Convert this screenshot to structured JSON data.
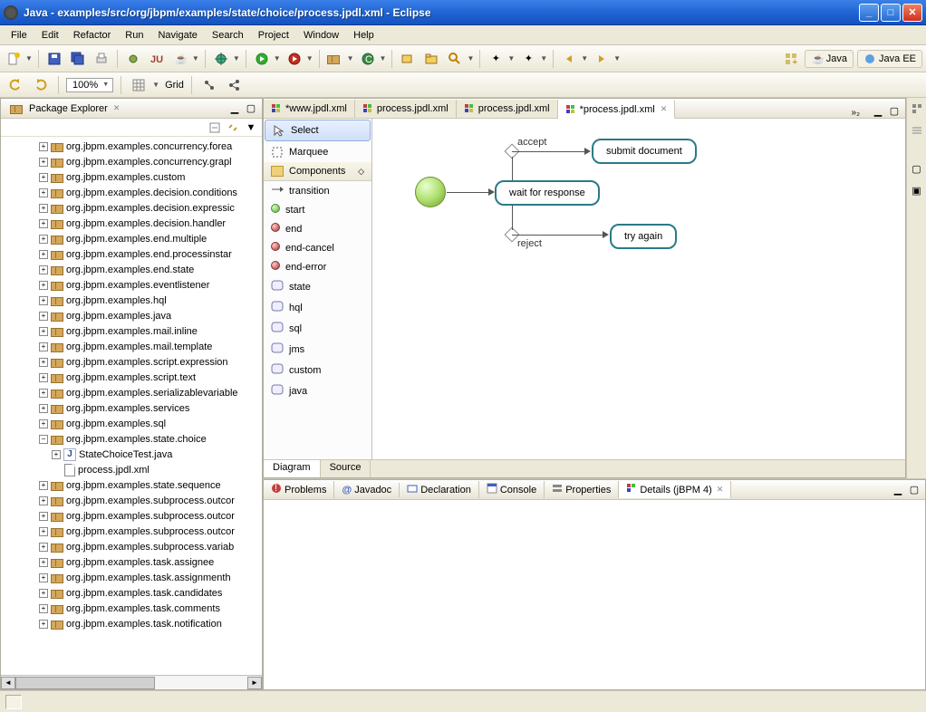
{
  "window": {
    "title": "Java - examples/src/org/jbpm/examples/state/choice/process.jpdl.xml - Eclipse"
  },
  "menu": {
    "items": [
      "File",
      "Edit",
      "Refactor",
      "Run",
      "Navigate",
      "Search",
      "Project",
      "Window",
      "Help"
    ]
  },
  "toolbar2": {
    "zoom": "100%",
    "grid_label": "Grid"
  },
  "perspectives": {
    "java": "Java",
    "javaee": "Java EE"
  },
  "package_explorer": {
    "title": "Package Explorer",
    "items": [
      "org.jbpm.examples.concurrency.forea",
      "org.jbpm.examples.concurrency.grapl",
      "org.jbpm.examples.custom",
      "org.jbpm.examples.decision.conditions",
      "org.jbpm.examples.decision.expressic",
      "org.jbpm.examples.decision.handler",
      "org.jbpm.examples.end.multiple",
      "org.jbpm.examples.end.processinstar",
      "org.jbpm.examples.end.state",
      "org.jbpm.examples.eventlistener",
      "org.jbpm.examples.hql",
      "org.jbpm.examples.java",
      "org.jbpm.examples.mail.inline",
      "org.jbpm.examples.mail.template",
      "org.jbpm.examples.script.expression",
      "org.jbpm.examples.script.text",
      "org.jbpm.examples.serializablevariable",
      "org.jbpm.examples.services",
      "org.jbpm.examples.sql"
    ],
    "expanded_item": "org.jbpm.examples.state.choice",
    "children": [
      {
        "label": "StateChoiceTest.java",
        "type": "java"
      },
      {
        "label": "process.jpdl.xml",
        "type": "file"
      }
    ],
    "items_after": [
      "org.jbpm.examples.state.sequence",
      "org.jbpm.examples.subprocess.outcor",
      "org.jbpm.examples.subprocess.outcor",
      "org.jbpm.examples.subprocess.outcor",
      "org.jbpm.examples.subprocess.variab",
      "org.jbpm.examples.task.assignee",
      "org.jbpm.examples.task.assignmenth",
      "org.jbpm.examples.task.candidates",
      "org.jbpm.examples.task.comments",
      "org.jbpm.examples.task.notification"
    ]
  },
  "editor": {
    "tabs": [
      "*www.jpdl.xml",
      "process.jpdl.xml",
      "process.jpdl.xml",
      "*process.jpdl.xml"
    ],
    "active_tab": 3,
    "overflow": "»₂",
    "bottom_tabs": [
      "Diagram",
      "Source"
    ],
    "active_bottom_tab": 0
  },
  "palette": {
    "select": "Select",
    "marquee": "Marquee",
    "section": "Components",
    "items": [
      "transition",
      "start",
      "end",
      "end-cancel",
      "end-error",
      "state",
      "hql",
      "sql",
      "jms",
      "custom",
      "java"
    ]
  },
  "diagram": {
    "node_wait": "wait for response",
    "node_submit": "submit document",
    "node_try": "try again",
    "label_accept": "accept",
    "label_reject": "reject"
  },
  "bottom_views": {
    "tabs": [
      "Problems",
      "Javadoc",
      "Declaration",
      "Console",
      "Properties",
      "Details (jBPM 4)"
    ],
    "active": 5
  }
}
